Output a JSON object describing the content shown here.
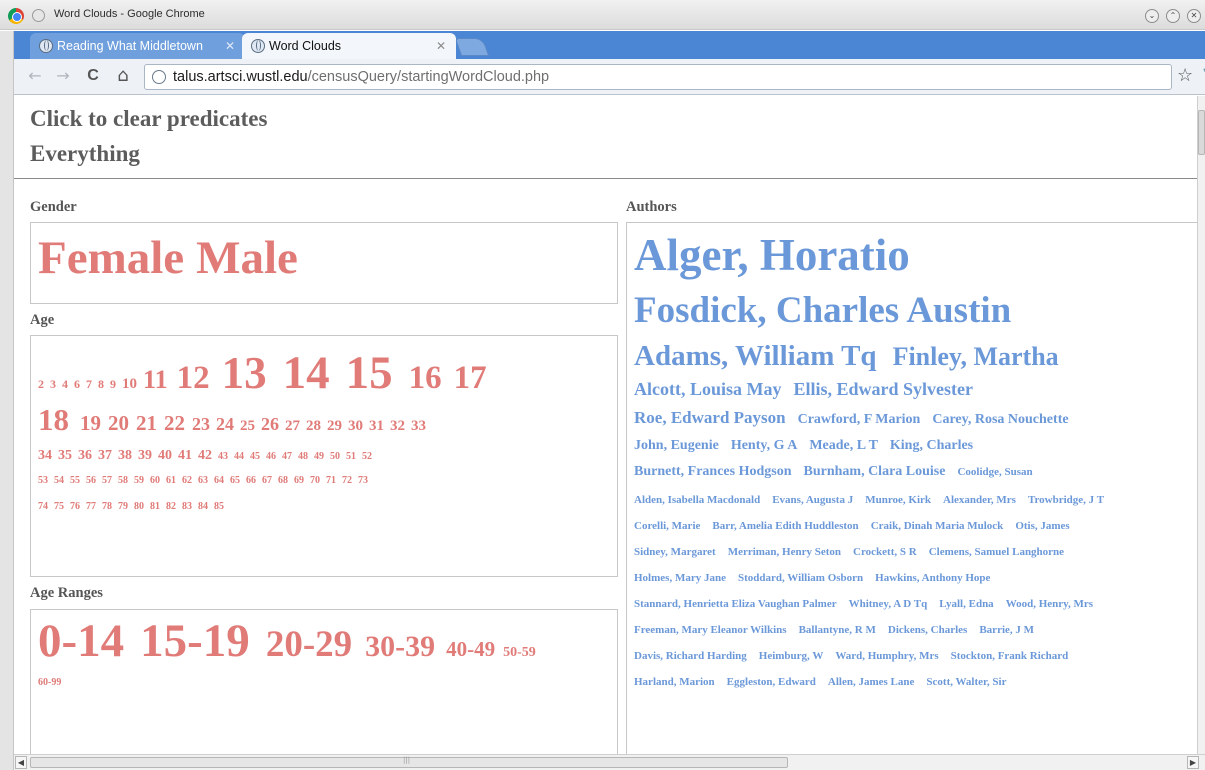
{
  "window": {
    "title": "Word Clouds - Google Chrome",
    "controls": [
      "⌄",
      "⌃",
      "✕"
    ]
  },
  "tabs": [
    {
      "label": "Reading What Middletown",
      "close": "✕",
      "active": false
    },
    {
      "label": "Word Clouds",
      "close": "✕",
      "active": true
    }
  ],
  "toolbar": {
    "back": "←",
    "forward": "→",
    "reload": "C",
    "home": "⌂",
    "url_host": "talus.artsci.wustl.edu",
    "url_path": "/censusQuery/startingWordCloud.php",
    "star": "☆",
    "wrench": "🔧"
  },
  "page": {
    "clear_link": "Click to clear predicates",
    "predicate": "Everything",
    "colors": {
      "red": "#e07b78",
      "blue": "#6b98d8"
    },
    "gender": {
      "label": "Gender",
      "items": [
        {
          "text": "Female",
          "size": 47
        },
        {
          "text": "Male",
          "size": 47
        }
      ]
    },
    "age": {
      "label": "Age",
      "lines": [
        [
          {
            "text": "2",
            "size": 12
          },
          {
            "text": "3",
            "size": 12
          },
          {
            "text": "4",
            "size": 12
          },
          {
            "text": "6",
            "size": 12
          },
          {
            "text": "7",
            "size": 12
          },
          {
            "text": "8",
            "size": 12
          },
          {
            "text": "9",
            "size": 12
          },
          {
            "text": "10",
            "size": 15
          },
          {
            "text": "11",
            "size": 26
          },
          {
            "text": "12",
            "size": 33
          },
          {
            "text": "13",
            "size": 45
          },
          {
            "text": "14",
            "size": 47
          },
          {
            "text": "15",
            "size": 47
          },
          {
            "text": "16",
            "size": 33
          },
          {
            "text": "17",
            "size": 33
          }
        ],
        [
          {
            "text": "18",
            "size": 31
          },
          {
            "text": "19",
            "size": 21
          },
          {
            "text": "20",
            "size": 21
          },
          {
            "text": "21",
            "size": 21
          },
          {
            "text": "22",
            "size": 21
          },
          {
            "text": "23",
            "size": 18
          },
          {
            "text": "24",
            "size": 18
          },
          {
            "text": "25",
            "size": 15
          },
          {
            "text": "26",
            "size": 18
          },
          {
            "text": "27",
            "size": 15
          },
          {
            "text": "28",
            "size": 15
          },
          {
            "text": "29",
            "size": 15
          },
          {
            "text": "30",
            "size": 15
          },
          {
            "text": "31",
            "size": 15
          },
          {
            "text": "32",
            "size": 15
          },
          {
            "text": "33",
            "size": 15
          }
        ],
        [
          {
            "text": "34",
            "size": 14
          },
          {
            "text": "35",
            "size": 14
          },
          {
            "text": "36",
            "size": 14
          },
          {
            "text": "37",
            "size": 14
          },
          {
            "text": "38",
            "size": 14
          },
          {
            "text": "39",
            "size": 14
          },
          {
            "text": "40",
            "size": 14
          },
          {
            "text": "41",
            "size": 14
          },
          {
            "text": "42",
            "size": 14
          },
          {
            "text": "43",
            "size": 10
          },
          {
            "text": "44",
            "size": 10
          },
          {
            "text": "45",
            "size": 10
          },
          {
            "text": "46",
            "size": 10
          },
          {
            "text": "47",
            "size": 10
          },
          {
            "text": "48",
            "size": 10
          },
          {
            "text": "49",
            "size": 10
          },
          {
            "text": "50",
            "size": 10
          },
          {
            "text": "51",
            "size": 10
          },
          {
            "text": "52",
            "size": 10
          }
        ],
        [
          {
            "text": "53",
            "size": 10
          },
          {
            "text": "54",
            "size": 10
          },
          {
            "text": "55",
            "size": 10
          },
          {
            "text": "56",
            "size": 10
          },
          {
            "text": "57",
            "size": 10
          },
          {
            "text": "58",
            "size": 10
          },
          {
            "text": "59",
            "size": 10
          },
          {
            "text": "60",
            "size": 10
          },
          {
            "text": "61",
            "size": 10
          },
          {
            "text": "62",
            "size": 10
          },
          {
            "text": "63",
            "size": 10
          },
          {
            "text": "64",
            "size": 10
          },
          {
            "text": "65",
            "size": 10
          },
          {
            "text": "66",
            "size": 10
          },
          {
            "text": "67",
            "size": 10
          },
          {
            "text": "68",
            "size": 10
          },
          {
            "text": "69",
            "size": 10
          },
          {
            "text": "70",
            "size": 10
          },
          {
            "text": "71",
            "size": 10
          },
          {
            "text": "72",
            "size": 10
          },
          {
            "text": "73",
            "size": 10
          }
        ],
        [
          {
            "text": "74",
            "size": 10
          },
          {
            "text": "75",
            "size": 10
          },
          {
            "text": "76",
            "size": 10
          },
          {
            "text": "77",
            "size": 10
          },
          {
            "text": "78",
            "size": 10
          },
          {
            "text": "79",
            "size": 10
          },
          {
            "text": "80",
            "size": 10
          },
          {
            "text": "81",
            "size": 10
          },
          {
            "text": "82",
            "size": 10
          },
          {
            "text": "83",
            "size": 10
          },
          {
            "text": "84",
            "size": 10
          },
          {
            "text": "85",
            "size": 10
          }
        ]
      ]
    },
    "age_ranges": {
      "label": "Age Ranges",
      "lines": [
        [
          {
            "text": "0-14",
            "size": 47
          },
          {
            "text": "15-19",
            "size": 47
          },
          {
            "text": "20-29",
            "size": 37
          },
          {
            "text": "30-39",
            "size": 30
          },
          {
            "text": "40-49",
            "size": 21
          },
          {
            "text": "50-59",
            "size": 14
          }
        ],
        [
          {
            "text": "60-99",
            "size": 10
          }
        ]
      ]
    },
    "authors": {
      "label": "Authors",
      "lines": [
        [
          {
            "text": "Alger, Horatio",
            "size": 45
          }
        ],
        [
          {
            "text": "Fosdick, Charles Austin",
            "size": 37
          }
        ],
        [
          {
            "text": "Adams, William Tq",
            "size": 29
          },
          {
            "text": "Finley, Martha",
            "size": 26
          }
        ],
        [
          {
            "text": "Alcott, Louisa May",
            "size": 18
          },
          {
            "text": "Ellis, Edward Sylvester",
            "size": 18
          }
        ],
        [
          {
            "text": "Roe, Edward Payson",
            "size": 17
          },
          {
            "text": "Crawford, F Marion",
            "size": 14
          },
          {
            "text": "Carey, Rosa Nouchette",
            "size": 14
          }
        ],
        [
          {
            "text": "John, Eugenie",
            "size": 14
          },
          {
            "text": "Henty, G A",
            "size": 14
          },
          {
            "text": "Meade, L T",
            "size": 14
          },
          {
            "text": "King, Charles",
            "size": 14
          }
        ],
        [
          {
            "text": "Burnett, Frances Hodgson",
            "size": 14
          },
          {
            "text": "Burnham, Clara Louise",
            "size": 14
          },
          {
            "text": "Coolidge, Susan",
            "size": 11
          }
        ],
        [
          {
            "text": "Alden, Isabella Macdonald",
            "size": 11
          },
          {
            "text": "Evans, Augusta J",
            "size": 11
          },
          {
            "text": "Munroe, Kirk",
            "size": 11
          },
          {
            "text": "Alexander, Mrs",
            "size": 11
          },
          {
            "text": "Trowbridge, J T",
            "size": 11
          }
        ],
        [
          {
            "text": "Corelli, Marie",
            "size": 11
          },
          {
            "text": "Barr, Amelia Edith Huddleston",
            "size": 11
          },
          {
            "text": "Craik, Dinah Maria Mulock",
            "size": 11
          },
          {
            "text": "Otis, James",
            "size": 11
          }
        ],
        [
          {
            "text": "Sidney, Margaret",
            "size": 11
          },
          {
            "text": "Merriman, Henry Seton",
            "size": 11
          },
          {
            "text": "Crockett, S R",
            "size": 11
          },
          {
            "text": "Clemens, Samuel Langhorne",
            "size": 11
          }
        ],
        [
          {
            "text": "Holmes, Mary Jane",
            "size": 11
          },
          {
            "text": "Stoddard, William Osborn",
            "size": 11
          },
          {
            "text": "Hawkins, Anthony Hope",
            "size": 11
          }
        ],
        [
          {
            "text": "Stannard, Henrietta Eliza Vaughan Palmer",
            "size": 11
          },
          {
            "text": "Whitney, A D Tq",
            "size": 11
          },
          {
            "text": "Lyall, Edna",
            "size": 11
          },
          {
            "text": "Wood, Henry, Mrs",
            "size": 11
          }
        ],
        [
          {
            "text": "Freeman, Mary Eleanor Wilkins",
            "size": 11
          },
          {
            "text": "Ballantyne, R M",
            "size": 11
          },
          {
            "text": "Dickens, Charles",
            "size": 11
          },
          {
            "text": "Barrie, J M",
            "size": 11
          }
        ],
        [
          {
            "text": "Davis, Richard Harding",
            "size": 11
          },
          {
            "text": "Heimburg, W",
            "size": 11
          },
          {
            "text": "Ward, Humphry, Mrs",
            "size": 11
          },
          {
            "text": "Stockton, Frank Richard",
            "size": 11
          }
        ],
        [
          {
            "text": "Harland, Marion",
            "size": 11
          },
          {
            "text": "Eggleston, Edward",
            "size": 11
          },
          {
            "text": "Allen, James Lane",
            "size": 11
          },
          {
            "text": "Scott, Walter, Sir",
            "size": 11
          }
        ]
      ]
    }
  },
  "scrollbar": {
    "left_arrow": "◀",
    "right_arrow": "▶",
    "grip": "|||"
  }
}
